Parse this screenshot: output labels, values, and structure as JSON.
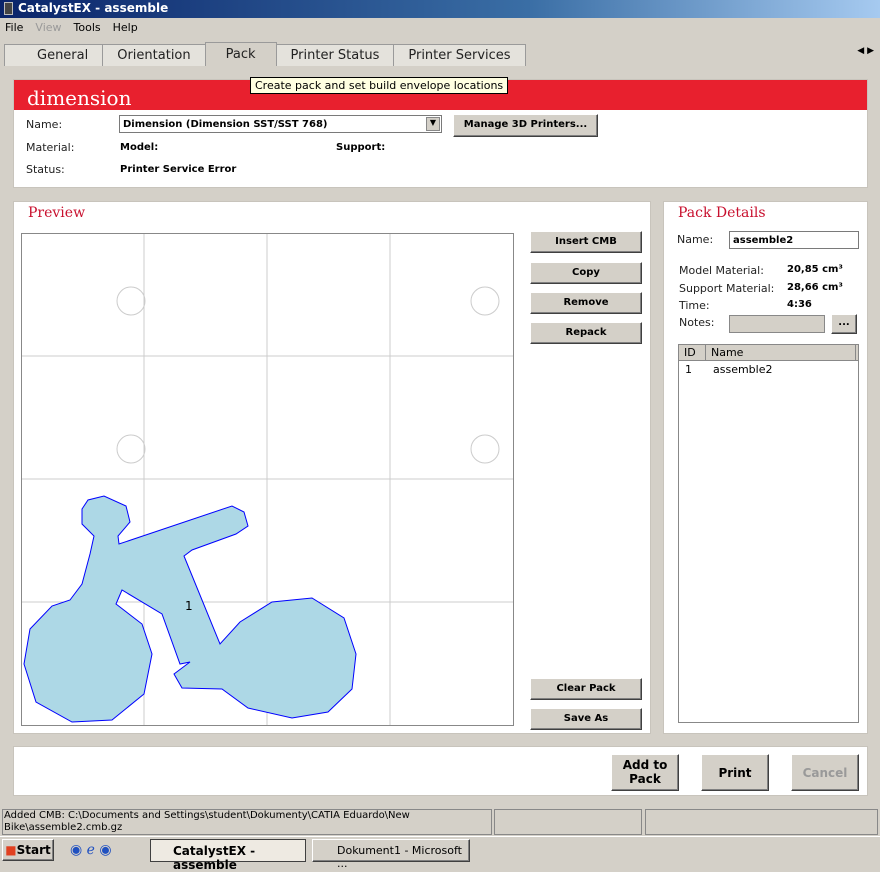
{
  "window": {
    "title": "CatalystEX - assemble"
  },
  "menu": [
    "File",
    "View",
    "Tools",
    "Help"
  ],
  "tabs": [
    "General",
    "Orientation",
    "Pack",
    "Printer Status",
    "Printer Services"
  ],
  "tooltip": "Create pack and set build envelope locations",
  "brand": "dimension",
  "printer": {
    "name_label": "Name:",
    "name_value": "Dimension  (Dimension SST/SST 768)",
    "manage_button": "Manage 3D Printers...",
    "material_label": "Material:",
    "model_label": "Model:",
    "support_label": "Support:",
    "status_label": "Status:",
    "status_value": "Printer Service Error"
  },
  "preview": {
    "title": "Preview",
    "part_label": "1",
    "buttons": [
      "Insert CMB",
      "Copy",
      "Remove",
      "Repack"
    ],
    "bottom_buttons": [
      "Clear Pack",
      "Save As"
    ]
  },
  "details": {
    "title": "Pack Details",
    "name_label": "Name:",
    "name_value": "assemble2",
    "model_material_label": "Model Material:",
    "model_material_value": "20,85 cm³",
    "support_material_label": "Support Material:",
    "support_material_value": "28,66 cm³",
    "time_label": "Time:",
    "time_value": "4:36",
    "notes_label": "Notes:",
    "notes_button": "...",
    "columns": [
      "ID",
      "Name"
    ],
    "rows": [
      {
        "id": "1",
        "name": "assemble2"
      }
    ]
  },
  "actions": {
    "add_to_pack": "Add to Pack",
    "print": "Print",
    "cancel": "Cancel"
  },
  "statusbar": {
    "message": "Added CMB: C:\\Documents and Settings\\student\\Dokumenty\\CATIA Eduardo\\New Bike\\assemble2.cmb.gz"
  },
  "taskbar": {
    "start": "Start",
    "items": [
      "CatalystEX - assemble",
      "Dokument1 - Microsoft ..."
    ]
  },
  "colors": {
    "accent": "#e8202e",
    "part_fill": "#add8e6",
    "part_stroke": "#0000ff"
  }
}
